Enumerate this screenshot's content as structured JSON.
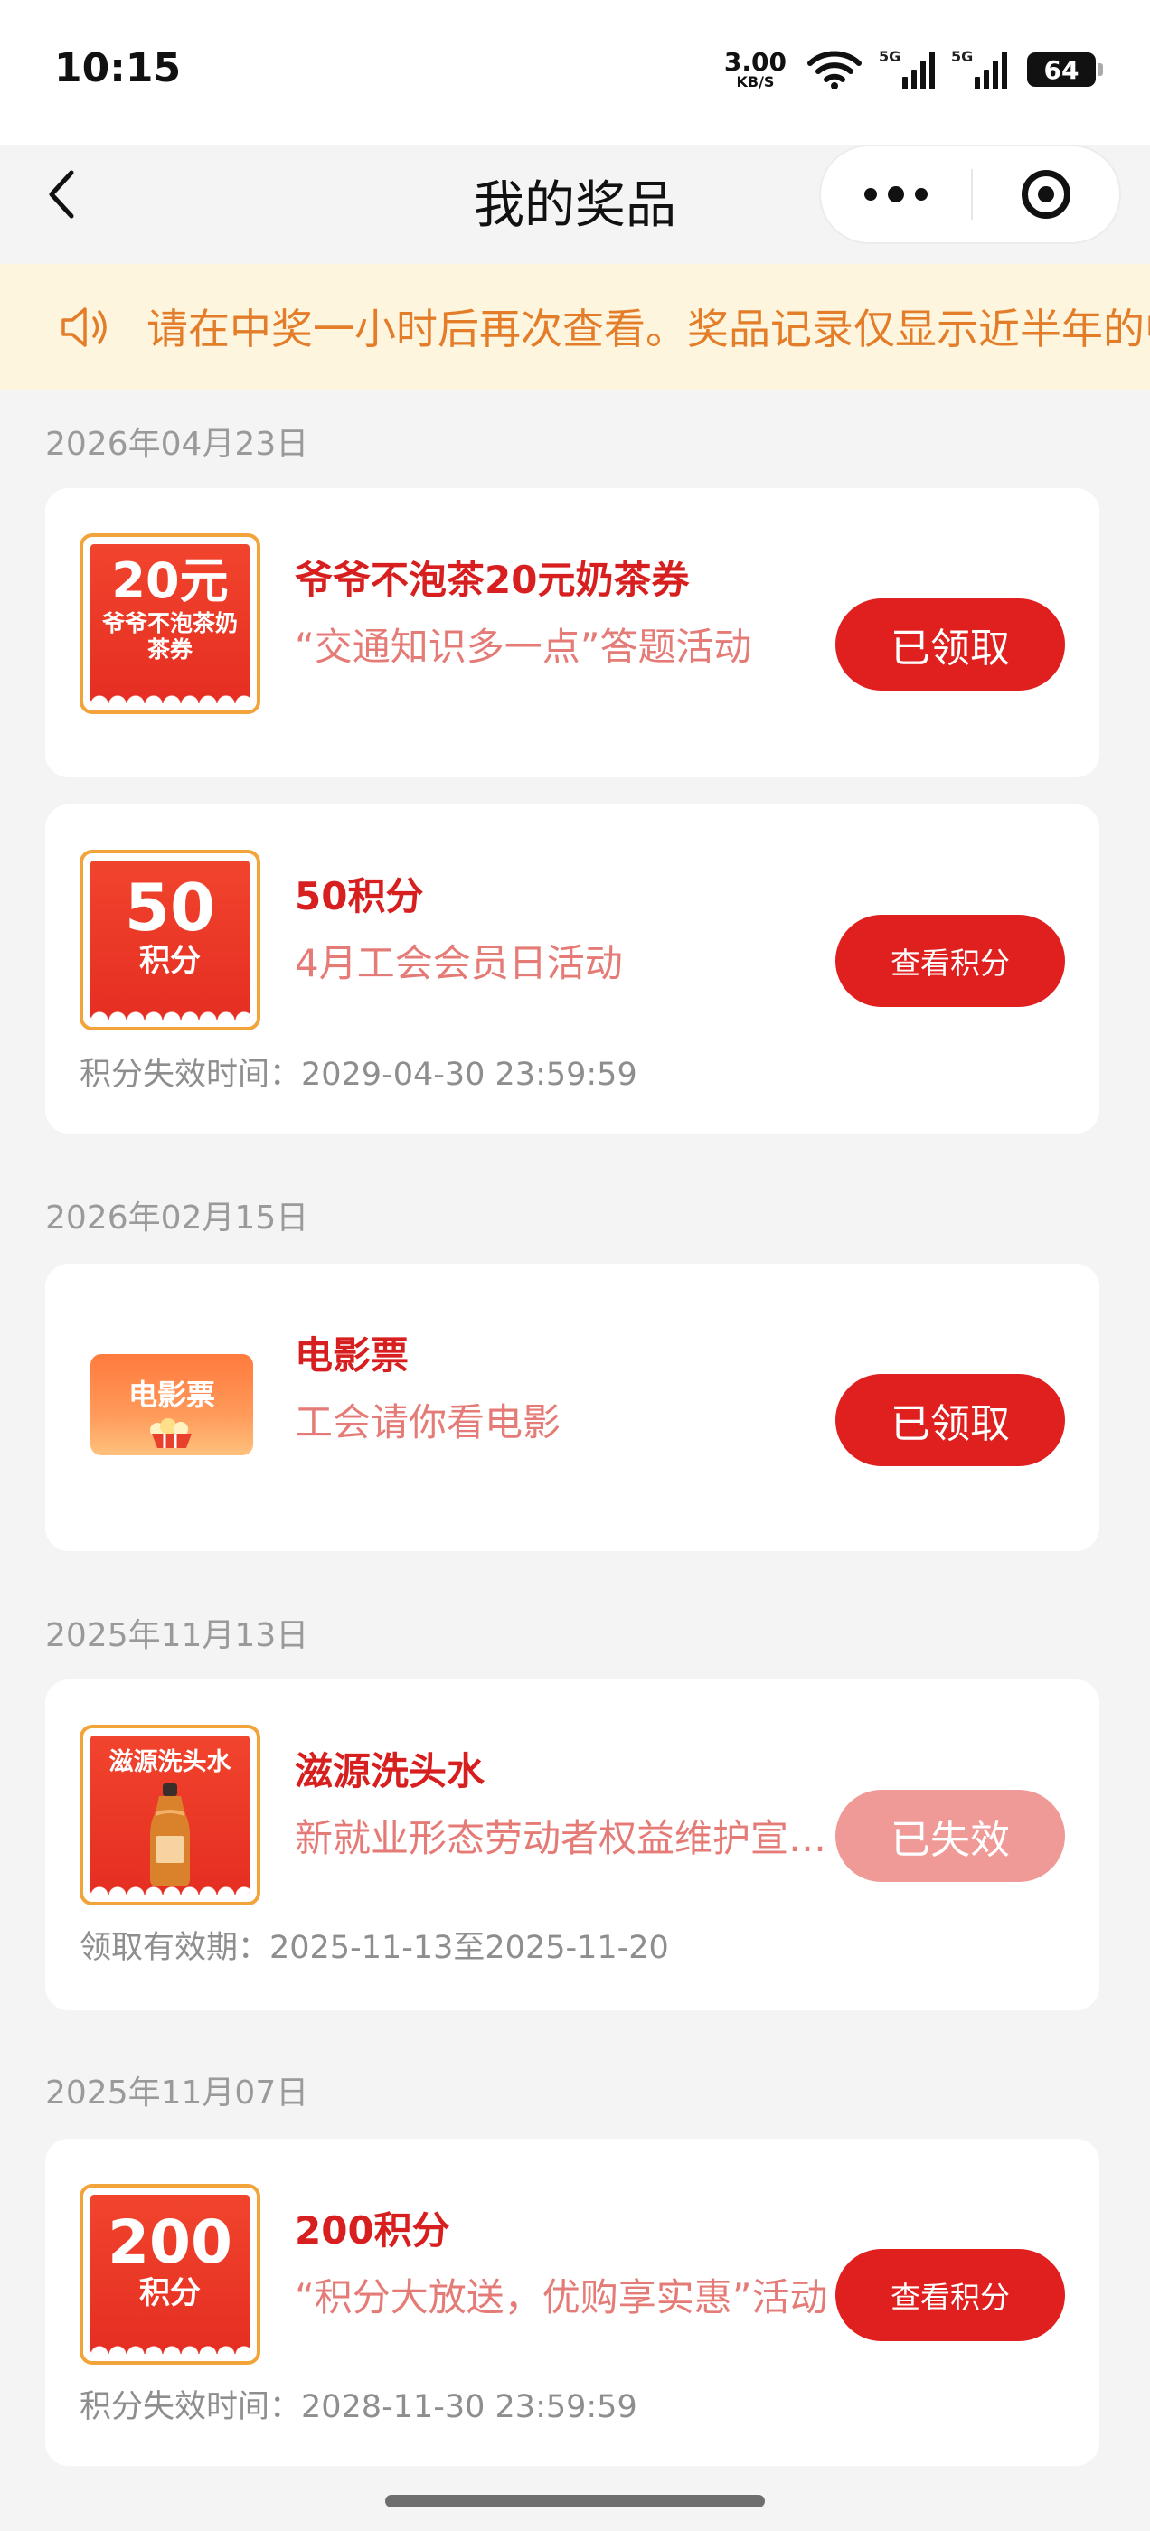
{
  "status_bar": {
    "time": "10:15",
    "net_speed_value": "3.00",
    "net_speed_unit": "KB/S",
    "signal_1_label": "5G",
    "signal_2_label": "5G",
    "battery": "64"
  },
  "header": {
    "title": "我的奖品"
  },
  "notice": {
    "text": "请在中奖一小时后再次查看。奖品记录仅显示近半年的中奖记录"
  },
  "groups": [
    {
      "date": "2026年04月23日",
      "prizes": [
        {
          "thumb_big": "20元",
          "thumb_small": "爷爷不泡茶奶茶券",
          "name": "爷爷不泡茶20元奶茶券",
          "desc": "“交通知识多一点”答题活动",
          "button": "已领取"
        },
        {
          "thumb_big": "50",
          "thumb_small": "积分",
          "name": "50积分",
          "desc": "4月工会会员日活动",
          "extra": "积分失效时间：2029-04-30 23:59:59",
          "button": "查看积分"
        }
      ]
    },
    {
      "date": "2026年02月15日",
      "prizes": [
        {
          "thumb_small": "电影票",
          "name": "电影票",
          "desc": "工会请你看电影",
          "button": "已领取"
        }
      ]
    },
    {
      "date": "2025年11月13日",
      "prizes": [
        {
          "thumb_small": "滋源洗头水",
          "name": "滋源洗头水",
          "desc": "新就业形态劳动者权益维护宣传活动",
          "extra": "领取有效期：2025-11-13至2025-11-20",
          "button": "已失效"
        }
      ]
    },
    {
      "date": "2025年11月07日",
      "prizes": [
        {
          "thumb_big": "200",
          "thumb_small": "积分",
          "name": "200积分",
          "desc": "“积分大放送，优购享实惠”活动",
          "extra": "积分失效时间：2028-11-30 23:59:59",
          "button": "查看积分"
        }
      ]
    }
  ]
}
